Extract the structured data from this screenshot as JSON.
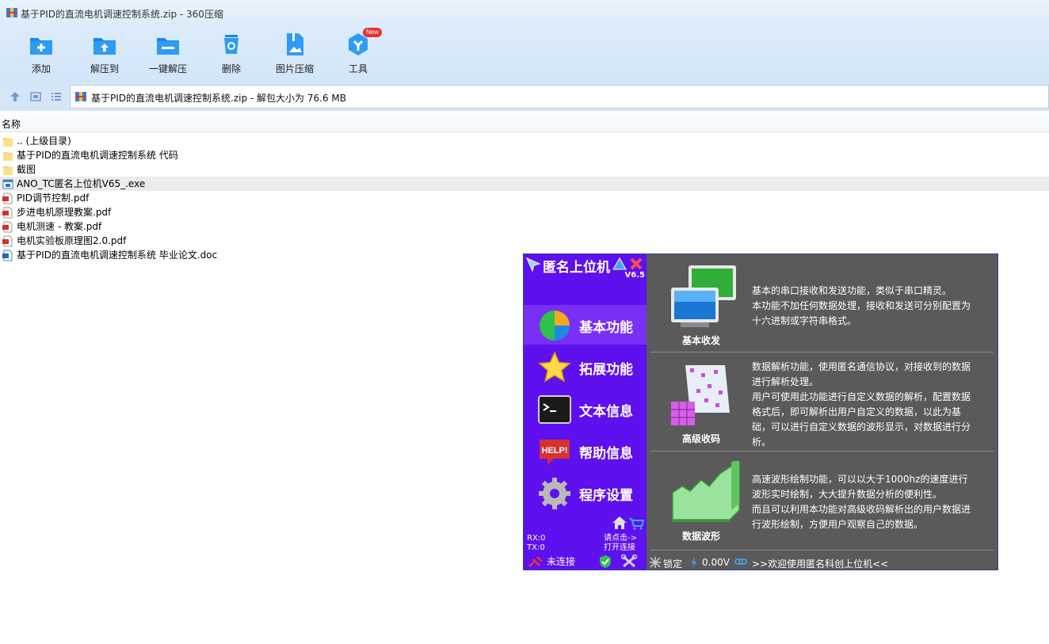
{
  "window": {
    "title": "基于PID的直流电机调速控制系统.zip - 360压缩"
  },
  "toolbar": {
    "buttons": [
      {
        "label": "添加",
        "icon": "add-icon"
      },
      {
        "label": "解压到",
        "icon": "extract-to-icon"
      },
      {
        "label": "一键解压",
        "icon": "one-click-extract-icon"
      },
      {
        "label": "删除",
        "icon": "delete-icon"
      },
      {
        "label": "图片压缩",
        "icon": "image-compress-icon"
      },
      {
        "label": "工具",
        "icon": "tools-icon",
        "badge": "New"
      }
    ]
  },
  "address": {
    "path": "基于PID的直流电机调速控制系统.zip - 解包大小为 76.6 MB"
  },
  "columns": {
    "name": "名称"
  },
  "files": [
    {
      "name": ".. (上级目录)",
      "type": "folder"
    },
    {
      "name": "基于PID的直流电机调速控制系统 代码",
      "type": "folder"
    },
    {
      "name": "截图",
      "type": "folder"
    },
    {
      "name": "ANO_TC匿名上位机V65_.exe",
      "type": "exe",
      "selected": true
    },
    {
      "name": "PID调节控制.pdf",
      "type": "pdf"
    },
    {
      "name": "步进电机原理教案.pdf",
      "type": "pdf"
    },
    {
      "name": "电机测速 - 教案.pdf",
      "type": "pdf"
    },
    {
      "name": "电机实验板原理图2.0.pdf",
      "type": "pdf"
    },
    {
      "name": "基于PID的直流电机调速控制系统 毕业论文.doc",
      "type": "doc"
    }
  ],
  "ano": {
    "brand": "匿名上位机",
    "version": "V6.5",
    "menu": [
      {
        "label": "基本功能",
        "icon": "pie-chart-icon",
        "active": true
      },
      {
        "label": "拓展功能",
        "icon": "star-icon"
      },
      {
        "label": "文本信息",
        "icon": "terminal-icon"
      },
      {
        "label": "帮助信息",
        "icon": "help-icon"
      },
      {
        "label": "程序设置",
        "icon": "gear-icon"
      }
    ],
    "help_badge": "HELP!",
    "rx": "RX:0",
    "tx": "TX:0",
    "click_hint": "请点击->",
    "open_conn": "打开连接",
    "conn_status": "未连接",
    "features": [
      {
        "title": "基本收发",
        "icon": "monitors-icon",
        "lines": [
          "基本的串口接收和发送功能，类似于串口精灵。",
          "本功能不加任何数据处理，接收和发送可分别配置为",
          "十六进制或字符串格式。"
        ]
      },
      {
        "title": "高级收码",
        "icon": "data-cubes-icon",
        "lines": [
          "数据解析功能，使用匿名通信协议，对接收到的数据",
          "进行解析处理。",
          "用户可使用此功能进行自定义数据的解析，配置数据",
          "格式后，即可解析出用户自定义的数据，以此为基",
          "础，可以进行自定义数据的波形显示，对数据进行分",
          "析。"
        ]
      },
      {
        "title": "数据波形",
        "icon": "waveform-icon",
        "lines": [
          "高速波形绘制功能，可以以大于1000hz的速度进行",
          "波形实时绘制，大大提升数据分析的便利性。",
          "而且可以利用本功能对高级收码解析出的用户数据进",
          "行波形绘制，方便用户观察自己的数据。"
        ]
      }
    ],
    "status": {
      "lock": "锁定",
      "voltage": "0.00V",
      "welcome": ">>欢迎使用匿名科创上位机<<"
    }
  }
}
